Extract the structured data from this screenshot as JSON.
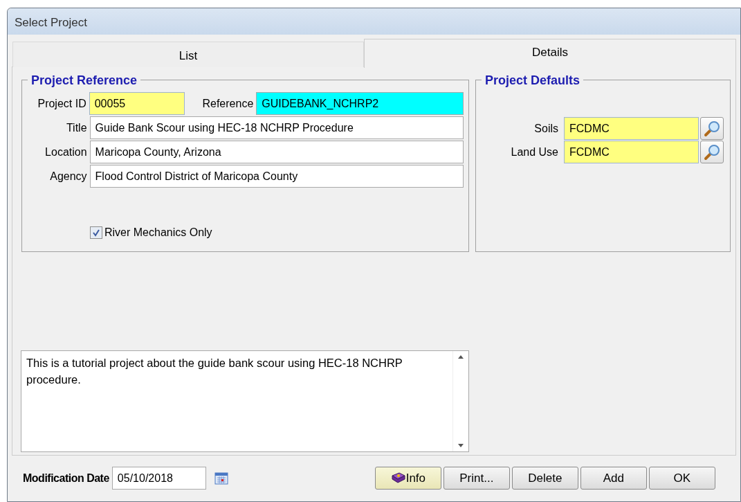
{
  "window": {
    "title": "Select Project"
  },
  "tabs": [
    {
      "label": "List",
      "selected": false
    },
    {
      "label": "Details",
      "selected": true
    }
  ],
  "project_reference": {
    "title": "Project Reference",
    "project_id": {
      "label": "Project ID",
      "value": "00055"
    },
    "reference": {
      "label": "Reference",
      "value": "GUIDEBANK_NCHRP2"
    },
    "fields": [
      {
        "label": "Title",
        "value": "Guide Bank Scour using HEC-18 NCHRP Procedure"
      },
      {
        "label": "Location",
        "value": "Maricopa County, Arizona"
      },
      {
        "label": "Agency",
        "value": "Flood Control District of Maricopa County"
      }
    ],
    "river_mechanics_only": {
      "label": "River Mechanics Only",
      "checked": true
    }
  },
  "project_defaults": {
    "title": "Project Defaults",
    "fields": [
      {
        "label": "Soils",
        "value": "FCDMC"
      },
      {
        "label": "Land Use",
        "value": "FCDMC"
      }
    ]
  },
  "notes": "This is a tutorial project about the guide bank scour using HEC-18 NCHRP procedure.",
  "modification_date": {
    "label": "Modification Date",
    "value": "05/10/2018"
  },
  "buttons": [
    {
      "label": "Info",
      "kind": "info"
    },
    {
      "label": "Print...",
      "kind": "plain"
    },
    {
      "label": "Delete",
      "kind": "plain"
    },
    {
      "label": "Add",
      "kind": "plain"
    },
    {
      "label": "OK",
      "kind": "plain"
    }
  ]
}
